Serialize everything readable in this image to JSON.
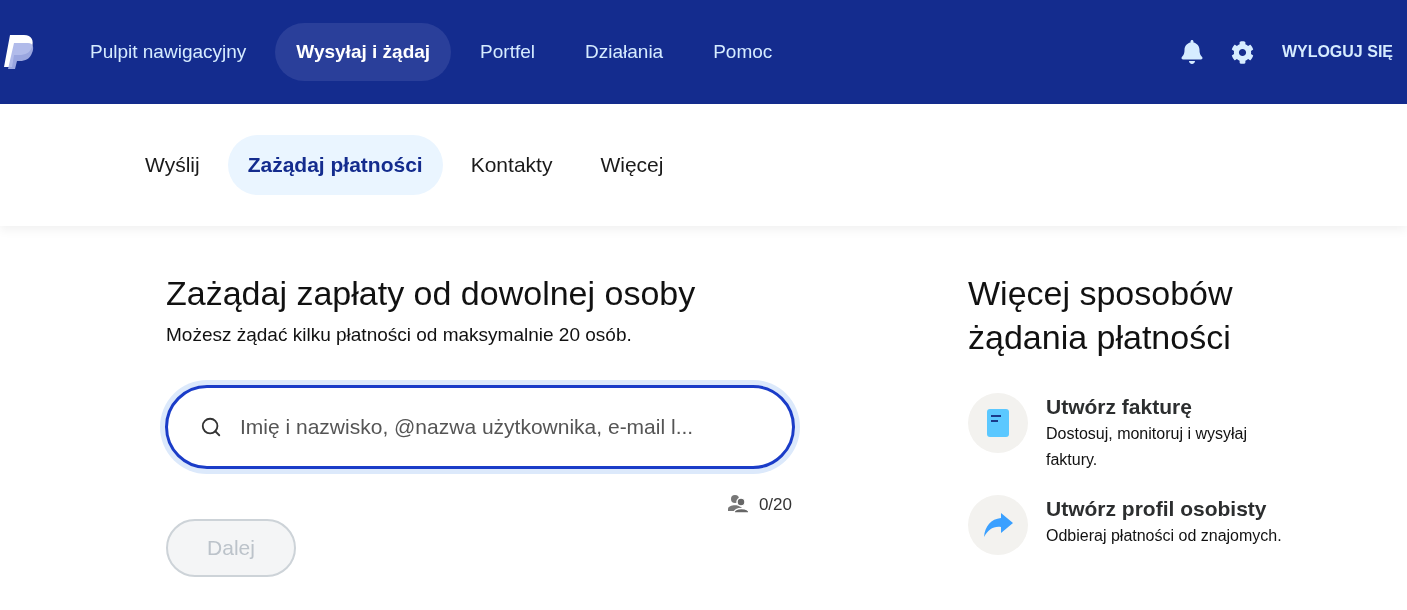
{
  "top_nav": {
    "items": [
      {
        "label": "Pulpit nawigacyjny",
        "selected": false
      },
      {
        "label": "Wysyłaj i żądaj",
        "selected": true
      },
      {
        "label": "Portfel",
        "selected": false
      },
      {
        "label": "Działania",
        "selected": false
      },
      {
        "label": "Pomoc",
        "selected": false
      }
    ],
    "logout": "WYLOGUJ SIĘ"
  },
  "sub_nav": {
    "items": [
      {
        "label": "Wyślij",
        "selected": false
      },
      {
        "label": "Zażądaj płatności",
        "selected": true
      },
      {
        "label": "Kontakty",
        "selected": false
      },
      {
        "label": "Więcej",
        "selected": false
      }
    ]
  },
  "request": {
    "title": "Zażądaj zapłaty od dowolnej osoby",
    "subtitle": "Możesz żądać kilku płatności od maksymalnie 20 osób.",
    "search": {
      "placeholder": "Imię i nazwisko, @nazwa użytkownika, e-mail l..."
    },
    "counter": "0/20",
    "next_button": {
      "label": "Dalej",
      "disabled": true
    }
  },
  "more_ways": {
    "title": "Więcej sposobów żądania płatności",
    "items": [
      {
        "kind": "invoice",
        "title": "Utwórz fakturę",
        "description": "Dostosuj, monitoruj i wysyłaj faktury."
      },
      {
        "kind": "profile",
        "title": "Utwórz profil osobisty",
        "description": "Odbieraj płatności od znajomych."
      }
    ]
  }
}
